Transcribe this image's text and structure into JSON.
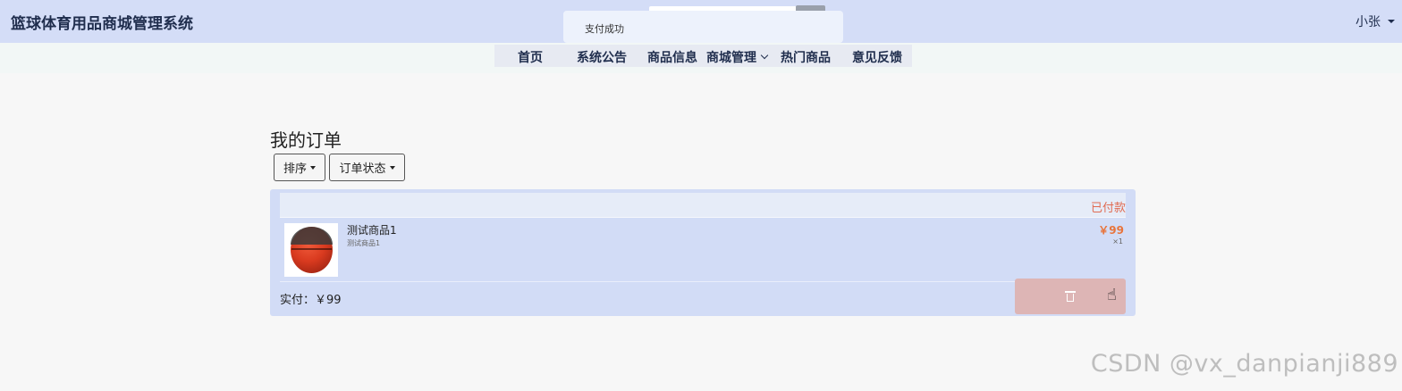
{
  "header": {
    "brand": "篮球体育用品商城管理系统",
    "user_name": "小张"
  },
  "toast": {
    "message": "支付成功"
  },
  "nav": {
    "items": [
      {
        "label": "首页"
      },
      {
        "label": "系统公告"
      },
      {
        "label": "商品信息"
      },
      {
        "label": "商城管理"
      },
      {
        "label": "热门商品"
      },
      {
        "label": "意见反馈"
      }
    ]
  },
  "page": {
    "title": "我的订单",
    "sort_label": "排序",
    "status_filter_label": "订单状态"
  },
  "order": {
    "status": "已付款",
    "item": {
      "name": "测试商品1",
      "desc": "测试商品1",
      "price": "￥99",
      "qty": "×1",
      "image_icon": "basketball-image"
    },
    "paid_label": "实付：￥99"
  },
  "watermark": "CSDN @vx_danpianji889",
  "colors": {
    "header_bg": "#d4ddf7",
    "card_bg": "#d2dcf6",
    "status_color": "#e06b52",
    "price_color": "#e8743b",
    "delete_bg": "#ddb5b5"
  }
}
